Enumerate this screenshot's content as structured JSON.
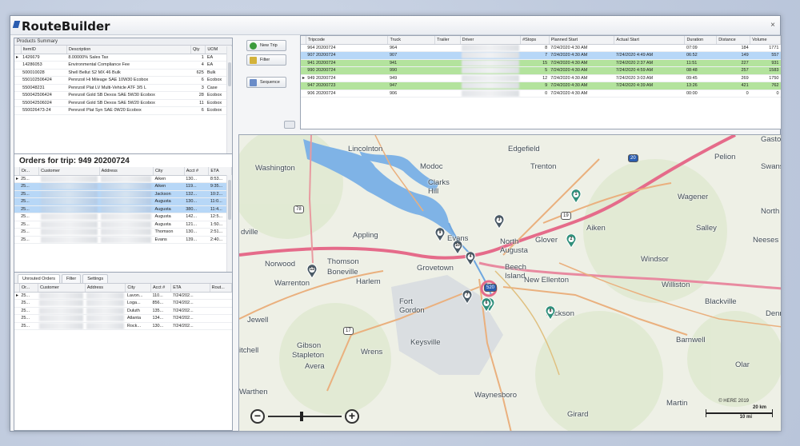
{
  "app": {
    "title": "RouteBuilder",
    "close_label": "×"
  },
  "products": {
    "title": "Products Summary",
    "columns": [
      "ItemID",
      "Description",
      "Qty",
      "UOM"
    ],
    "rows": [
      [
        "1426679",
        "8.00000% Sales Tax",
        "1",
        "EA"
      ],
      [
        "14286053",
        "Environmental Compliance Fee",
        "4",
        "EA"
      ],
      [
        "500010028",
        "Shell Bellut S2 MX 46 Bulk",
        "625",
        "Bulk"
      ],
      [
        "550102506424",
        "Pennzoil Hi Mileage SAE 10W30 Ecobox",
        "6",
        "Ecobox"
      ],
      [
        "550048231",
        "Pennzoil Plat LV Multi-Vehicle ATF 3/5 L",
        "3",
        "Case"
      ],
      [
        "550042506424",
        "Pennzoil Gold SB Dexos SAE 5W30 Ecobox",
        "28",
        "Ecobox"
      ],
      [
        "550042506024",
        "Pennzoil Gold SB Dexos SAE 5W20 Ecobox",
        "11",
        "Ecobox"
      ],
      [
        "550026473-24",
        "Pennzoil Plat Syn SAE 0W20 Ecobox",
        "6",
        "Ecobox"
      ]
    ]
  },
  "orders": {
    "title": "Orders for trip: 949 20200724",
    "columns": [
      "Or...",
      "Customer",
      "Address",
      "City",
      "Acct #",
      "ETA"
    ],
    "rows": [
      {
        "or": "25...",
        "city": "Aiken",
        "acct": "130...",
        "eta": "8:53..."
      },
      {
        "or": "25...",
        "city": "Aiken",
        "acct": "119...",
        "eta": "9:35..."
      },
      {
        "or": "25...",
        "city": "Jackson",
        "acct": "132...",
        "eta": "10:2..."
      },
      {
        "or": "25...",
        "city": "Augusta",
        "acct": "130...",
        "eta": "11:0..."
      },
      {
        "or": "25...",
        "city": "Augusta",
        "acct": "380...",
        "eta": "11:4..."
      },
      {
        "or": "25...",
        "city": "Augusta",
        "acct": "142...",
        "eta": "12:5..."
      },
      {
        "or": "25...",
        "city": "Augusta",
        "acct": "121...",
        "eta": "1:50..."
      },
      {
        "or": "25...",
        "city": "Thomson",
        "acct": "130...",
        "eta": "2:51..."
      },
      {
        "or": "25...",
        "city": "Evans",
        "acct": "139...",
        "eta": "2:40..."
      }
    ]
  },
  "unrouted": {
    "tabs": [
      "Unrouted Orders",
      "Filter",
      "Settings"
    ],
    "columns": [
      "Or...",
      "Customer",
      "Address",
      "City",
      "Acct #",
      "ETA",
      "Rout..."
    ],
    "rows": [
      {
        "or": "25...",
        "city": "Lavon...",
        "acct": "110...",
        "eta": "7/24/202..."
      },
      {
        "or": "25...",
        "city": "Loga...",
        "acct": "856...",
        "eta": "7/24/202..."
      },
      {
        "or": "25...",
        "city": "Duluth",
        "acct": "135...",
        "eta": "7/24/202..."
      },
      {
        "or": "25...",
        "city": "Atlanta",
        "acct": "134...",
        "eta": "7/24/202..."
      },
      {
        "or": "25...",
        "city": "Rock...",
        "acct": "130...",
        "eta": "7/24/202..."
      }
    ]
  },
  "buttons": {
    "new_trip": "New Trip",
    "filter": "Filter",
    "sequence": "Sequence"
  },
  "trips": {
    "columns": [
      "Tripcode",
      "Truck",
      "Trailer",
      "Driver",
      "#Stops",
      "Planned Start",
      "Actual Start",
      "Duration",
      "Distance",
      "Volume"
    ],
    "rows": [
      {
        "code": "964 20200724",
        "truck": "964",
        "stops": "8",
        "planned": "7/24/2020 4:30 AM",
        "actual": "",
        "dur": "07:09",
        "dist": "184",
        "vol": "1771",
        "style": ""
      },
      {
        "code": "907 20200724",
        "truck": "907",
        "stops": "7",
        "planned": "7/24/2020 4:30 AM",
        "actual": "7/24/2020 4:49 AM",
        "dur": "06:52",
        "dist": "149",
        "vol": "557",
        "style": "sel"
      },
      {
        "code": "941 20200724",
        "truck": "941",
        "stops": "15",
        "planned": "7/24/2020 4:30 AM",
        "actual": "7/24/2020 2:37 AM",
        "dur": "11:51",
        "dist": "227",
        "vol": "931",
        "style": "grn"
      },
      {
        "code": "990 20200724",
        "truck": "990",
        "stops": "5",
        "planned": "7/24/2020 4:30 AM",
        "actual": "7/24/2020 4:59 AM",
        "dur": "08:48",
        "dist": "257",
        "vol": "1583",
        "style": "grn"
      },
      {
        "code": "949 20200724",
        "truck": "949",
        "stops": "12",
        "planned": "7/24/2020 4:30 AM",
        "actual": "7/24/2020 3:03 AM",
        "dur": "09:45",
        "dist": "269",
        "vol": "1750",
        "style": "cur"
      },
      {
        "code": "947 20200723",
        "truck": "947",
        "stops": "9",
        "planned": "7/24/2020 4:30 AM",
        "actual": "7/24/2020 4:39 AM",
        "dur": "13:26",
        "dist": "421",
        "vol": "762",
        "style": "grn"
      },
      {
        "code": "906 20200724",
        "truck": "906",
        "stops": "0",
        "planned": "7/24/2020 4:30 AM",
        "actual": "",
        "dur": "00:00",
        "dist": "0",
        "vol": "0",
        "style": ""
      }
    ]
  },
  "map": {
    "labels": {
      "lincolnton": "Lincolnton",
      "edgefield": "Edgefield",
      "pelion": "Pelion",
      "gaston": "Gasto",
      "washington": "Washington",
      "modoc": "Modoc",
      "trenton": "Trenton",
      "swans": "Swans",
      "clarks_hill": "Clarks\nHill",
      "wagener": "Wagener",
      "north": "North",
      "aiken": "Aiken",
      "salley": "Salley",
      "appling": "Appling",
      "evans": "Evans",
      "north_augusta": "North\nAugusta",
      "glover": "Glover",
      "neeses": "Neeses",
      "dville": "dville",
      "norwood": "Norwood",
      "thomson": "Thomson",
      "boneville": "Boneville",
      "grovetown": "Grovetown",
      "beech_island": "Beech\nIsland",
      "windsor": "Windsor",
      "new_ellenton": "New Ellenton",
      "warrenton": "Warrenton",
      "harlem": "Harlem",
      "williston": "Williston",
      "fort_gordon": "Fort\nGordon",
      "jackson": "Jackson",
      "blackville": "Blackville",
      "jewell": "Jewell",
      "denmark": "Denmark",
      "gibson": "Gibson",
      "stapleton": "Stapleton",
      "keysville": "Keysville",
      "barnwell": "Barnwell",
      "mitchell": "itchell",
      "wrens": "Wrens",
      "avera": "Avera",
      "olar": "Olar",
      "warthen": "Warthen",
      "waynesboro": "Waynesboro",
      "martin": "Martin",
      "girard": "Girard"
    },
    "routes": {
      "r78": "78",
      "r20": "20",
      "r19": "19",
      "r17": "17",
      "r520": "520"
    },
    "pins": [
      "1",
      "2",
      "3",
      "4",
      "5",
      "6",
      "7",
      "8",
      "9",
      "10",
      "11"
    ],
    "copyright": "© HERE 2019",
    "scale_km": "20 km",
    "scale_mi": "10 mi",
    "zoom_out": "−",
    "zoom_in": "+"
  }
}
